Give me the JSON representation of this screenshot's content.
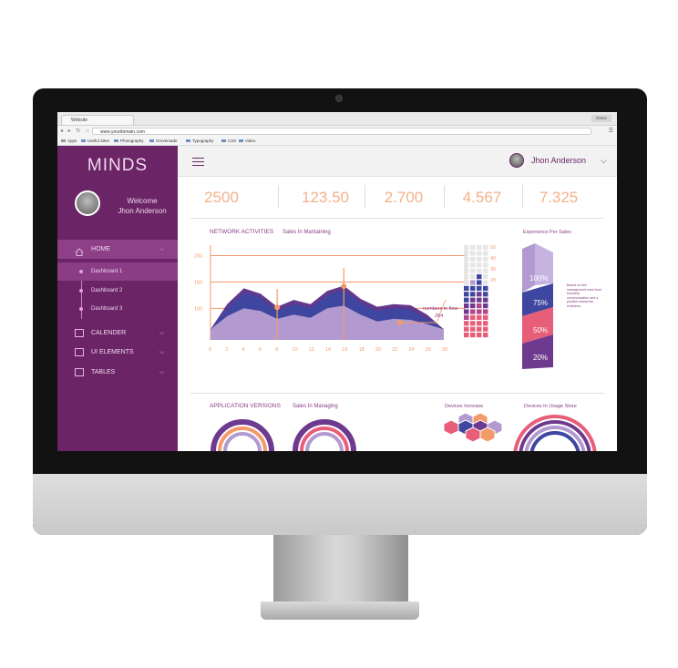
{
  "browser": {
    "tab_title": "Website",
    "window_user": "Daine",
    "url": "www.yourdomain.com",
    "bookmarks": [
      "Apps",
      "Useful Sites",
      "Photography",
      "Grovemade",
      "Typography",
      "CSS",
      "Video"
    ]
  },
  "sidebar": {
    "brand": "MINDS",
    "welcome_line1": "Welcome",
    "welcome_line2": "Jhon Anderson",
    "menu": [
      {
        "label": "HOME",
        "icon": "home-icon"
      },
      {
        "label": "CALENDER",
        "icon": "calendar-icon"
      },
      {
        "label": "UI ELEMENTS",
        "icon": "ui-elements-icon"
      },
      {
        "label": "TABLES",
        "icon": "tables-icon"
      }
    ],
    "submenu": [
      "Dashboard 1",
      "Dashboard 2",
      "Dashboard 3"
    ]
  },
  "header": {
    "user_name": "Jhon Anderson"
  },
  "stats": [
    "2500",
    "123.50",
    "2.700",
    "4.567",
    "7.325"
  ],
  "network": {
    "title": "NETWORK ACTIVITIES",
    "subtitle": "Sales In Mantaining",
    "callout_line1": "numbers in flow",
    "callout_line2": "264"
  },
  "experience": {
    "title": "Experience Per Sales",
    "labels": [
      "100%",
      "75%",
      "50%",
      "20%"
    ],
    "note": "Based on this management must fund business communication and a positive enterprise endeavor."
  },
  "bottom": {
    "app_versions_title": "APPLICATION VERSIONS",
    "app_versions_sub": "Sales In Managing",
    "devices_increase": "Devices Increase",
    "devices_usage": "Devices In Usage Store"
  },
  "chart_data": {
    "type": "area",
    "y_ticks": [
      "200",
      "150",
      "100"
    ],
    "x": [
      "0",
      "2",
      "4",
      "6",
      "8",
      "10",
      "12",
      "14",
      "16",
      "18",
      "20",
      "22",
      "24",
      "26",
      "28"
    ],
    "ylim": [
      40,
      220
    ],
    "series": [
      {
        "values": [
          60,
          100,
          130,
          120,
          95,
          108,
          100,
          125,
          135,
          110,
          95,
          100,
          98,
          80,
          60
        ]
      },
      {
        "values": [
          60,
          85,
          100,
          95,
          80,
          88,
          82,
          100,
          105,
          88,
          75,
          80,
          78,
          70,
          60
        ]
      }
    ],
    "bar_ticks": [
      "50",
      "40",
      "30",
      "20"
    ],
    "colors": {
      "back": "#5a2e86",
      "mid": "#3f46a0",
      "front": "#b29ad0",
      "accent": "#f39a6a"
    }
  }
}
